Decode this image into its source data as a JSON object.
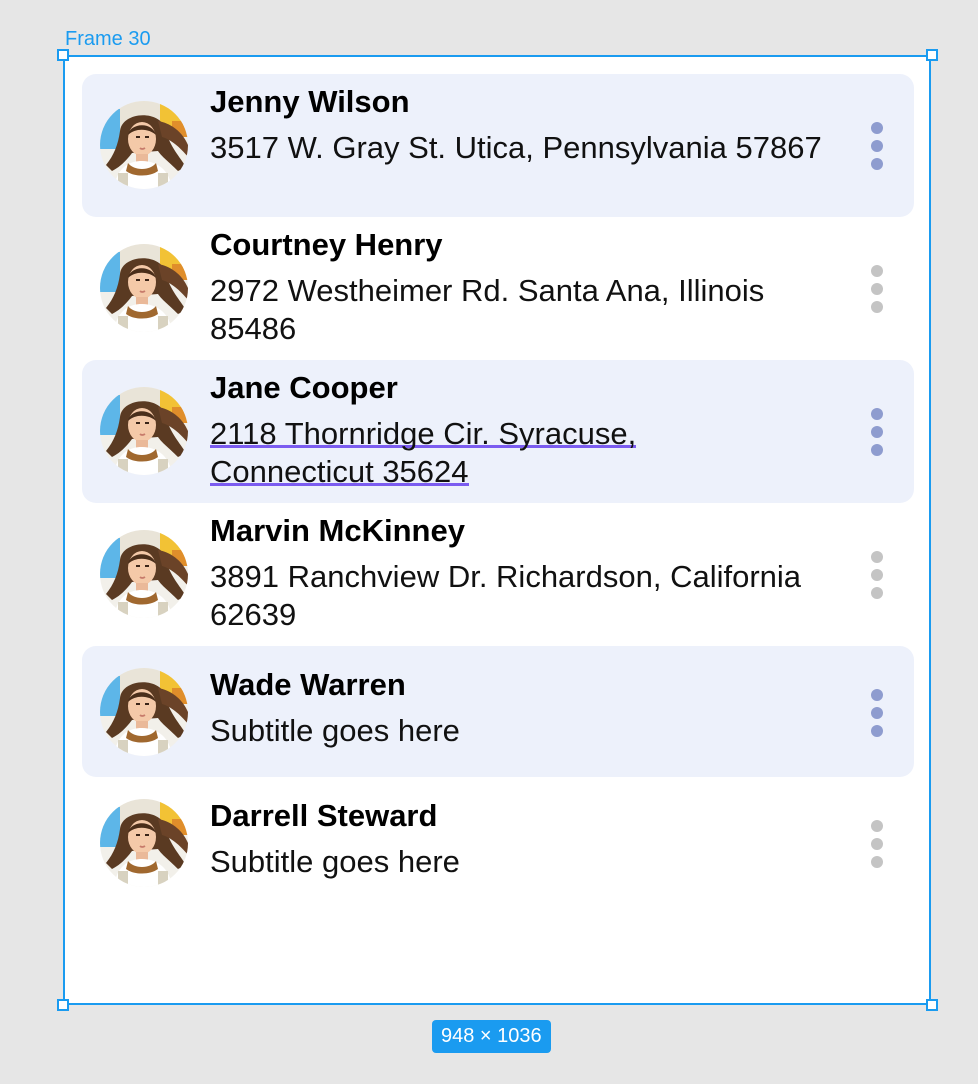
{
  "frame": {
    "label": "Frame 30",
    "size_badge": "948 × 1036"
  },
  "contacts": [
    {
      "name": "Jenny Wilson",
      "subtitle": "3517 W. Gray St. Utica, Pennsylvania 57867"
    },
    {
      "name": "Courtney Henry",
      "subtitle": "2972 Westheimer Rd. Santa Ana, Illinois 85486"
    },
    {
      "name": "Jane Cooper",
      "subtitle_line1": "2118 Thornridge Cir. Syracuse,",
      "subtitle_line2": "Connecticut 35624"
    },
    {
      "name": "Marvin McKinney",
      "subtitle": "3891 Ranchview Dr. Richardson, California 62639"
    },
    {
      "name": "Wade Warren",
      "subtitle": "Subtitle goes here"
    },
    {
      "name": "Darrell Steward",
      "subtitle": "Subtitle goes here"
    }
  ],
  "colors": {
    "selection": "#1a9bf0",
    "row_highlight": "#edf1fb",
    "dots_active": "#8e9ccf",
    "dots_inactive": "#c4c4c4",
    "spellcheck_underline": "#7b5cf0"
  },
  "icons": {
    "row_menu": "more-vertical-icon"
  }
}
